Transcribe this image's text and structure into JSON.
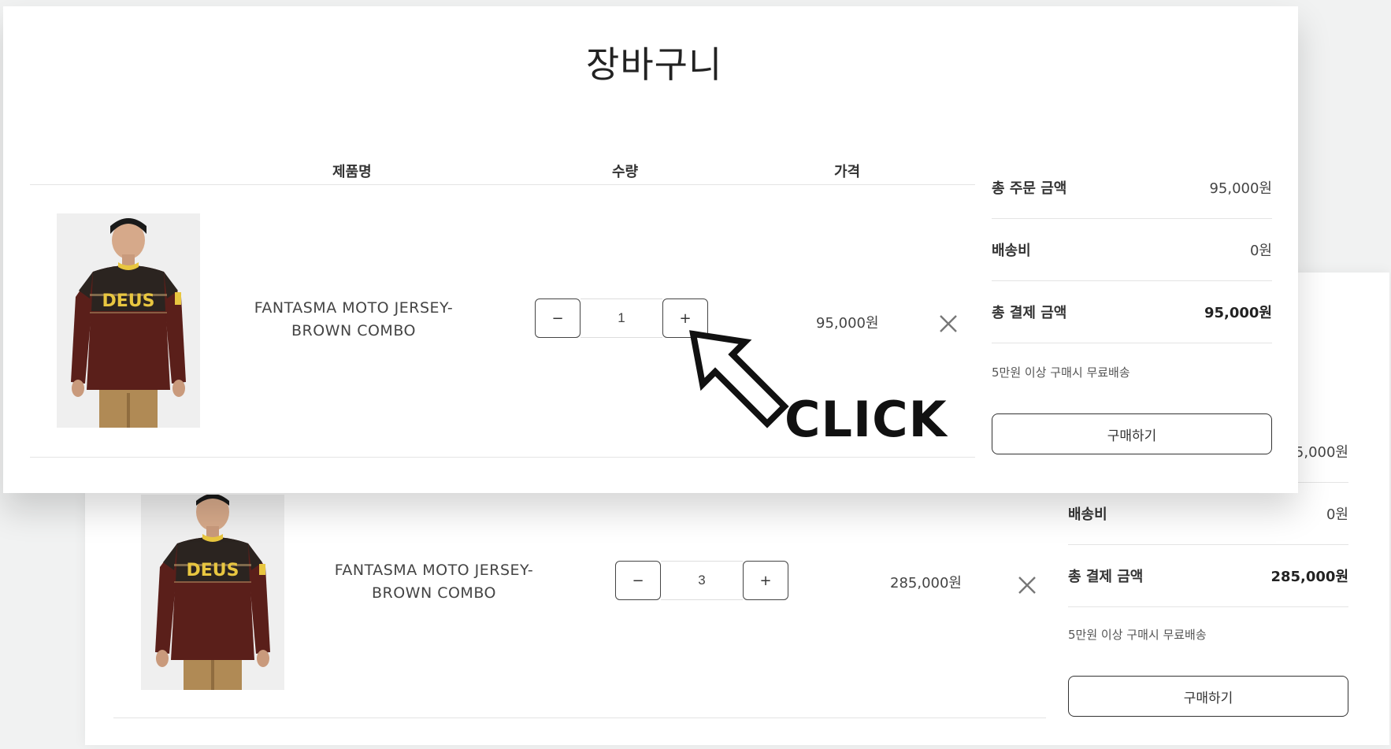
{
  "cart": {
    "title": "장바구니",
    "columns": {
      "product": "제품명",
      "quantity": "수량",
      "price": "가격"
    }
  },
  "before": {
    "product_line1": "FANTASMA MOTO JERSEY-",
    "product_line2": "BROWN COMBO",
    "quantity": "1",
    "price": "95,000원",
    "minus_label": "−",
    "plus_label": "+",
    "summary": {
      "order_total_label": "총 주문 금액",
      "order_total_value": "95,000원",
      "shipping_label": "배송비",
      "shipping_value": "0원",
      "payment_total_label": "총 결제 금액",
      "payment_total_value": "95,000원",
      "free_shipping_note": "5만원 이상 구매시 무료배송",
      "buy_label": "구매하기"
    }
  },
  "after": {
    "product_line1": "FANTASMA MOTO JERSEY-",
    "product_line2": "BROWN COMBO",
    "quantity": "3",
    "price": "285,000원",
    "minus_label": "−",
    "plus_label": "+",
    "summary": {
      "order_total_value_partial": "5,000원",
      "shipping_label": "배송비",
      "shipping_value": "0원",
      "payment_total_label": "총 결제 금액",
      "payment_total_value": "285,000원",
      "free_shipping_note": "5만원 이상 구매시 무료배송",
      "buy_label": "구매하기"
    }
  },
  "annotation": {
    "click_text": "CLICK"
  },
  "product_image": {
    "logo_text": "DEUS",
    "jersey_color": "#5a1f1a",
    "yoke_color": "#2b2420",
    "collar_color": "#e8c640",
    "pants_color": "#b08a55"
  },
  "icons": {
    "remove": "close-icon",
    "arrow": "arrow-pointer-icon"
  }
}
